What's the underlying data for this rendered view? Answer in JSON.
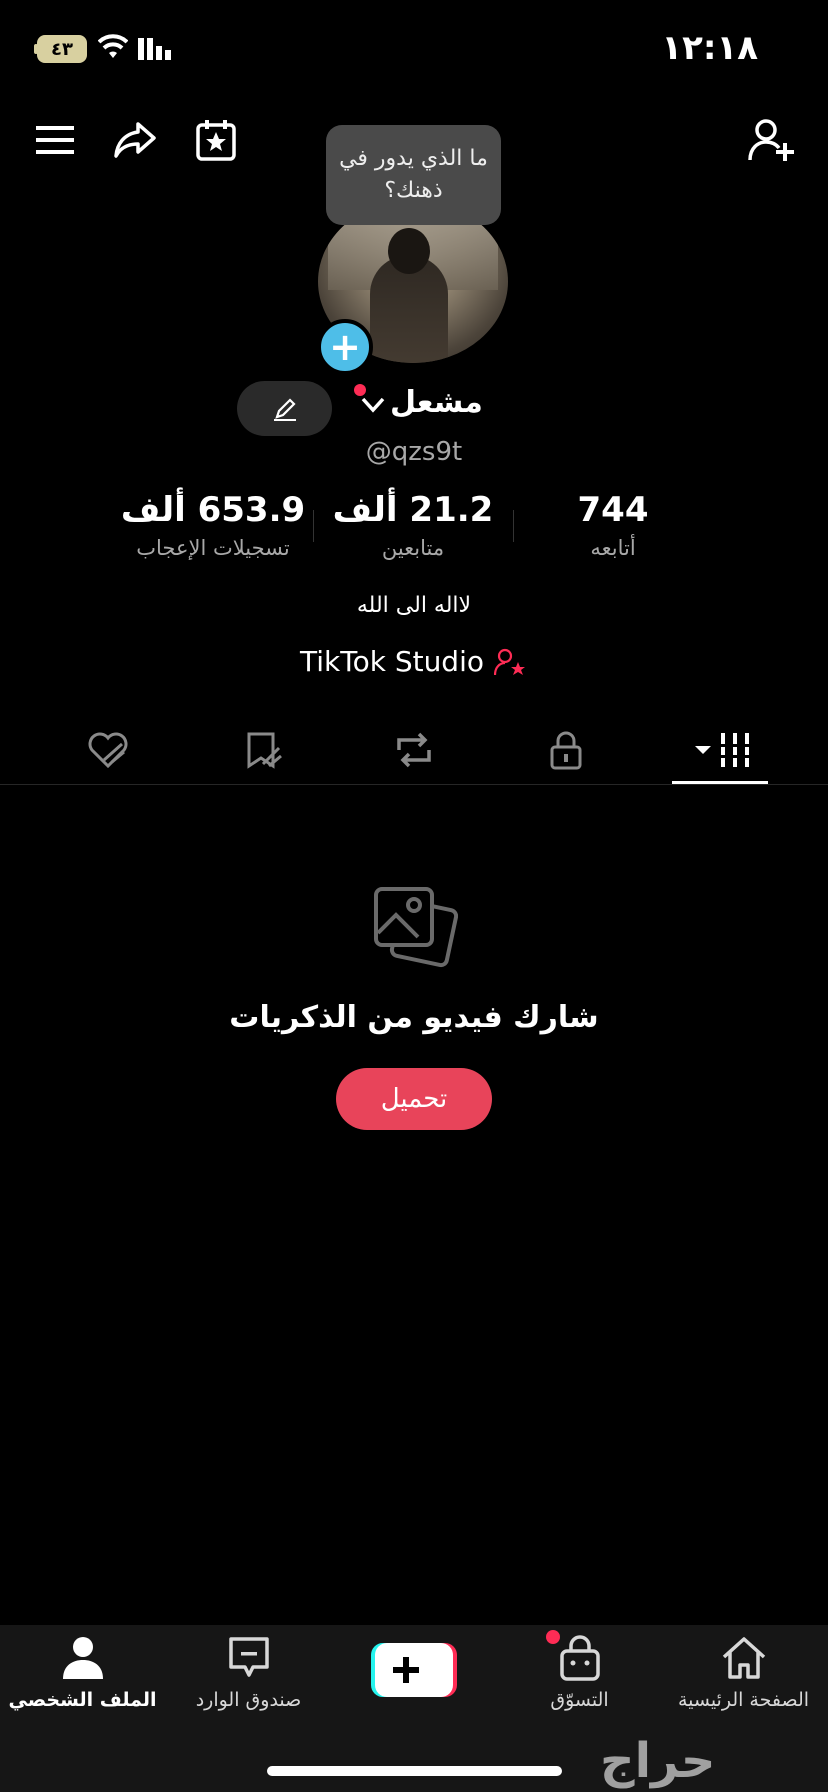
{
  "status_bar": {
    "time": "١٢:١٨",
    "battery": "٤٣"
  },
  "profile": {
    "bubble_text": "ما الذي يدور في ذهنك؟",
    "name": "مشعل",
    "handle": "@qzs9t",
    "bio": "لااله الى الله",
    "studio_label": "TikTok Studio"
  },
  "stats": [
    {
      "value": "744",
      "label": "أتابعه"
    },
    {
      "value": "21.2 ألف",
      "label": "متابعين"
    },
    {
      "value": "653.9 ألف",
      "label": "تسجيلات الإعجاب"
    }
  ],
  "tabs": [
    "videos-grid",
    "private-lock",
    "reposts",
    "favorites",
    "liked"
  ],
  "empty_state": {
    "title": "شارك فيديو من الذكريات",
    "button": "تحميل"
  },
  "bottom_nav": {
    "home": "الصفحة الرئيسية",
    "shop": "التسوّق",
    "inbox": "صندوق الوارد",
    "profile": "الملف الشخصي"
  },
  "watermark": "حراج",
  "colors": {
    "accent": "#fe2c55",
    "button": "#e8445a",
    "badge": "#4ebee8"
  }
}
